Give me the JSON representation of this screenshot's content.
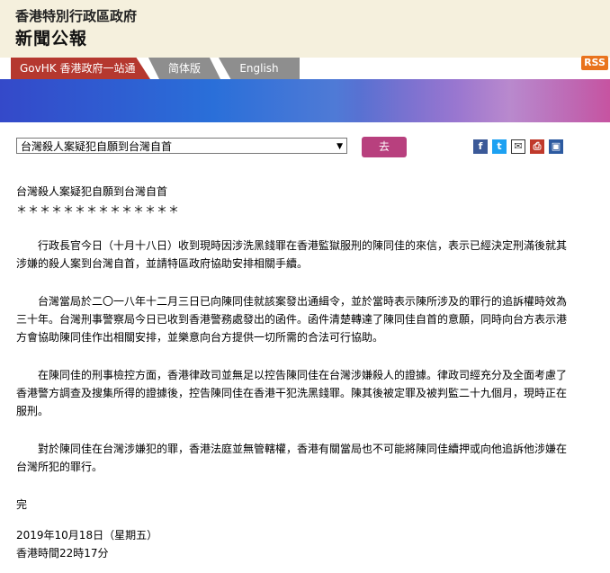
{
  "header": {
    "line1": "香港特別行政區政府",
    "line2": "新聞公報"
  },
  "nav": {
    "govhk": "GovHK 香港政府一站通",
    "simplified": "简体版",
    "english": "English",
    "rss": "RSS"
  },
  "selector": {
    "value": "台灣殺人案疑犯自願到台灣自首",
    "go": "去"
  },
  "icons": [
    "facebook-icon",
    "twitter-icon",
    "email-icon",
    "print-icon",
    "bookmark-icon"
  ],
  "article": {
    "title": "台灣殺人案疑犯自願到台灣自首",
    "stars": "＊＊＊＊＊＊＊＊＊＊＊＊＊＊",
    "p1a": "行政長官今日（十月十八日）收到現時因涉洗黑錢罪在香港監獄服刑的陳同佳的來信，表示已經決定刑滿後就其",
    "p1b": "涉嫌的殺人案到台灣自首，並請特區政府協助安排相關手續。",
    "p2a": "台灣當局於二〇一八年十二月三日已向陳同佳就該案發出通緝令，並於當時表示陳所涉及的罪行的追訴權時效為",
    "p2b": "三十年。台灣刑事警察局今日已收到香港警務處發出的函件。函件清楚轉達了陳同佳自首的意願，同時向台方表示港",
    "p2c": "方會協助陳同佳作出相關安排，並樂意向台方提供一切所需的合法可行協助。",
    "p3a": "在陳同佳的刑事檢控方面，香港律政司並無足以控告陳同佳在台灣涉嫌殺人的證據。律政司經充分及全面考慮了",
    "p3b": "香港警方調查及搜集所得的證據後，控告陳同佳在香港干犯洗黑錢罪。陳其後被定罪及被判監二十九個月，現時正在",
    "p3c": "服刑。",
    "p4a": "對於陳同佳在台灣涉嫌犯的罪，香港法庭並無管轄權，香港有關當局也不可能將陳同佳續押或向他追訴他涉嫌在",
    "p4b": "台灣所犯的罪行。",
    "end": "完",
    "date": "2019年10月18日（星期五）",
    "time": "香港時間22時17分"
  }
}
